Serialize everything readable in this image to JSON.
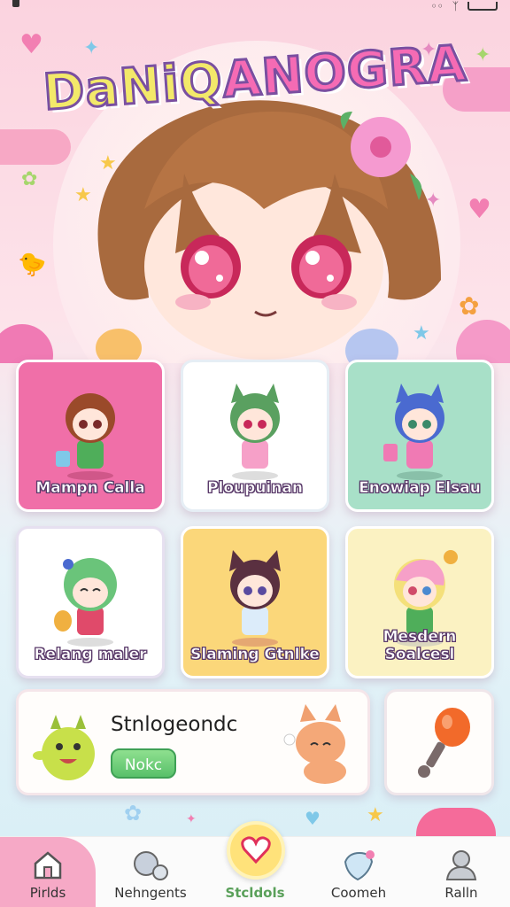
{
  "app": {
    "title_part1": "DaNiQ",
    "title_part2": "ANOGRA"
  },
  "cards": [
    {
      "label": "Mampn Calla",
      "bg": "#f06fa8"
    },
    {
      "label": "Ploupuinan",
      "bg": "#ffffff"
    },
    {
      "label": "Enowiap Elsau",
      "bg": "#a8e0c8"
    },
    {
      "label": "Relang maler",
      "bg": "#ffffff"
    },
    {
      "label": "Slaming Gtnlke",
      "bg": "#fbd77a"
    },
    {
      "label": "Mesdern Soalcesl",
      "bg": "#fbf2c2"
    }
  ],
  "featured": {
    "title": "Stnlogeondc",
    "button_label": "Nokc"
  },
  "nav": {
    "items": [
      {
        "label": "Pirlds",
        "icon": "home-icon"
      },
      {
        "label": "Nehngents",
        "icon": "bubbles-icon"
      },
      {
        "label": "Stcldols",
        "icon": "heart-icon"
      },
      {
        "label": "Coomeh",
        "icon": "gem-icon"
      },
      {
        "label": "Ralln",
        "icon": "user-icon"
      }
    ]
  },
  "colors": {
    "accent_pink": "#f06fa8",
    "nav_active": "#f6a9c6",
    "center_button": "#ffe27a",
    "nav_center_label": "#5aa05a"
  }
}
